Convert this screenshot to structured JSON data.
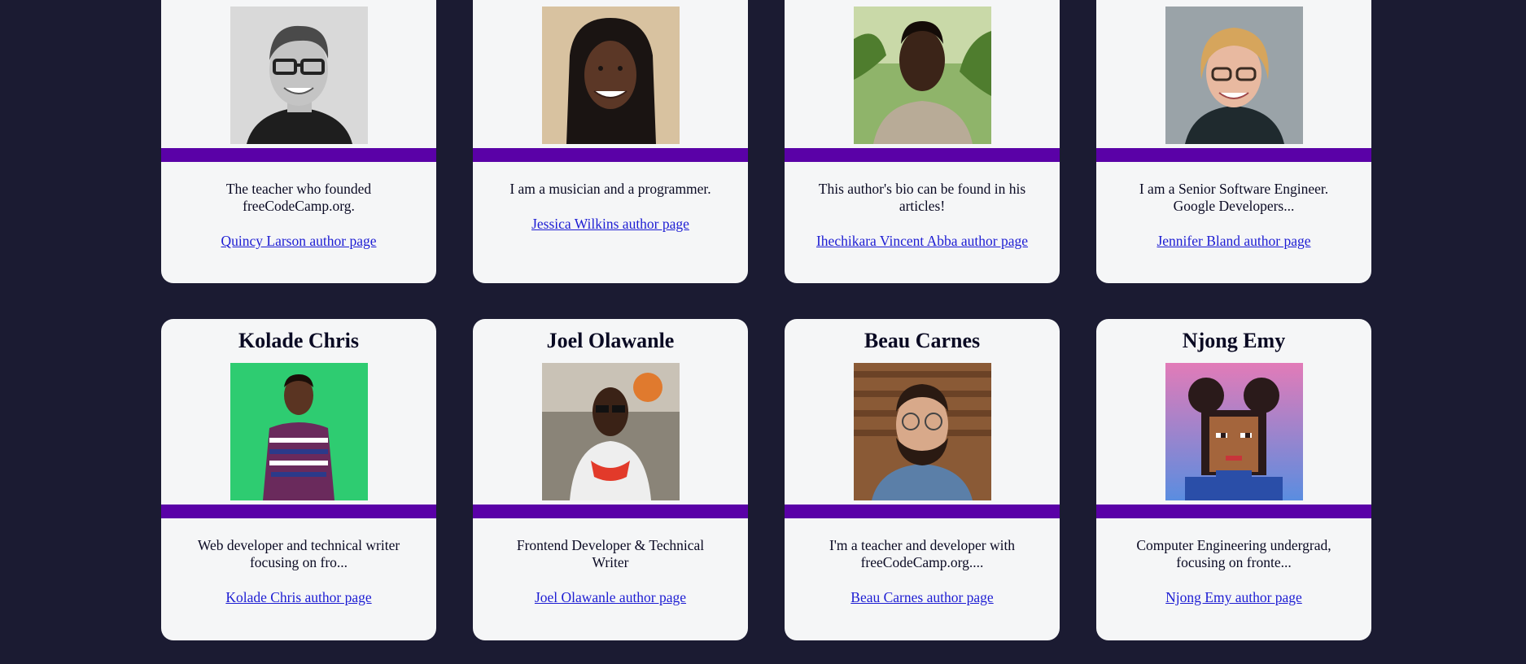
{
  "authors": [
    {
      "name": "Quincy Larson",
      "bio": "The teacher who founded freeCodeCamp.org.",
      "link": "Quincy Larson author page",
      "avatar_icon": "person-photo-icon"
    },
    {
      "name": "Jessica Wilkins",
      "bio": "I am a musician and a programmer.",
      "link": "Jessica Wilkins author page",
      "avatar_icon": "person-photo-icon"
    },
    {
      "name": "Ihechikara Vincent Abba",
      "bio": "This author's bio can be found in his articles!",
      "link": "Ihechikara Vincent Abba author page",
      "avatar_icon": "person-photo-icon"
    },
    {
      "name": "Jennifer Bland",
      "bio": "I am a Senior Software Engineer. Google Developers...",
      "link": "Jennifer Bland author page",
      "avatar_icon": "person-photo-icon"
    },
    {
      "name": "Kolade Chris",
      "bio": "Web developer and technical writer focusing on fro...",
      "link": "Kolade Chris author page",
      "avatar_icon": "person-photo-icon"
    },
    {
      "name": "Joel Olawanle",
      "bio": "Frontend Developer & Technical Writer",
      "link": "Joel Olawanle author page",
      "avatar_icon": "person-photo-icon"
    },
    {
      "name": "Beau Carnes",
      "bio": "I'm a teacher and developer with freeCodeCamp.org....",
      "link": "Beau Carnes author page",
      "avatar_icon": "person-photo-icon"
    },
    {
      "name": "Njong Emy",
      "bio": "Computer Engineering undergrad, focusing on fronte...",
      "link": "Njong Emy author page",
      "avatar_icon": "pixel-avatar-icon"
    }
  ],
  "colors": {
    "page_background": "#1b1b32",
    "card_background": "#f5f6f7",
    "accent_bar": "#5a01a7",
    "link": "#1d1dd3"
  }
}
